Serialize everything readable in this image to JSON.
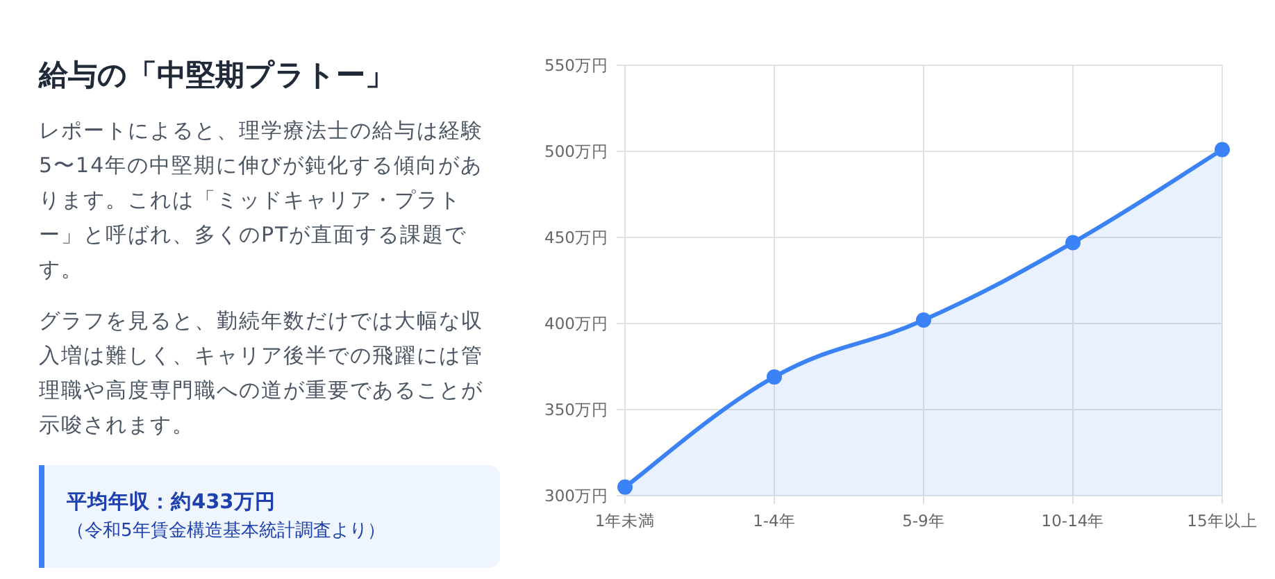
{
  "heading": "給与の「中堅期プラトー」",
  "paragraphs": [
    "レポートによると、理学療法士の給与は経験5〜14年の中堅期に伸びが鈍化する傾向があります。これは「ミッドキャリア・プラトー」と呼ばれ、多くのPTが直面する課題です。",
    "グラフを見ると、勤続年数だけでは大幅な収入増は難しく、キャリア後半での飛躍には管理職や高度専門職への道が重要であることが示唆されます。"
  ],
  "callout": {
    "title": "平均年収：約433万円",
    "note": "（令和5年賃金構造基本統計調査より）"
  },
  "chart": {
    "chart_data": {
      "type": "area",
      "grid": true,
      "categories": [
        "1年未満",
        "1-4年",
        "5-9年",
        "10-14年",
        "15年以上"
      ],
      "series": [
        {
          "color": "#3b82f6",
          "values": [
            305,
            369,
            402,
            447,
            501
          ]
        }
      ],
      "ylim": [
        300,
        550
      ],
      "yticks": [
        {
          "value": 300,
          "label": "300万円"
        },
        {
          "value": 350,
          "label": "350万円"
        },
        {
          "value": 400,
          "label": "400万円"
        },
        {
          "value": 450,
          "label": "450万円"
        },
        {
          "value": 500,
          "label": "500万円"
        },
        {
          "value": 550,
          "label": "550万円"
        }
      ]
    }
  }
}
